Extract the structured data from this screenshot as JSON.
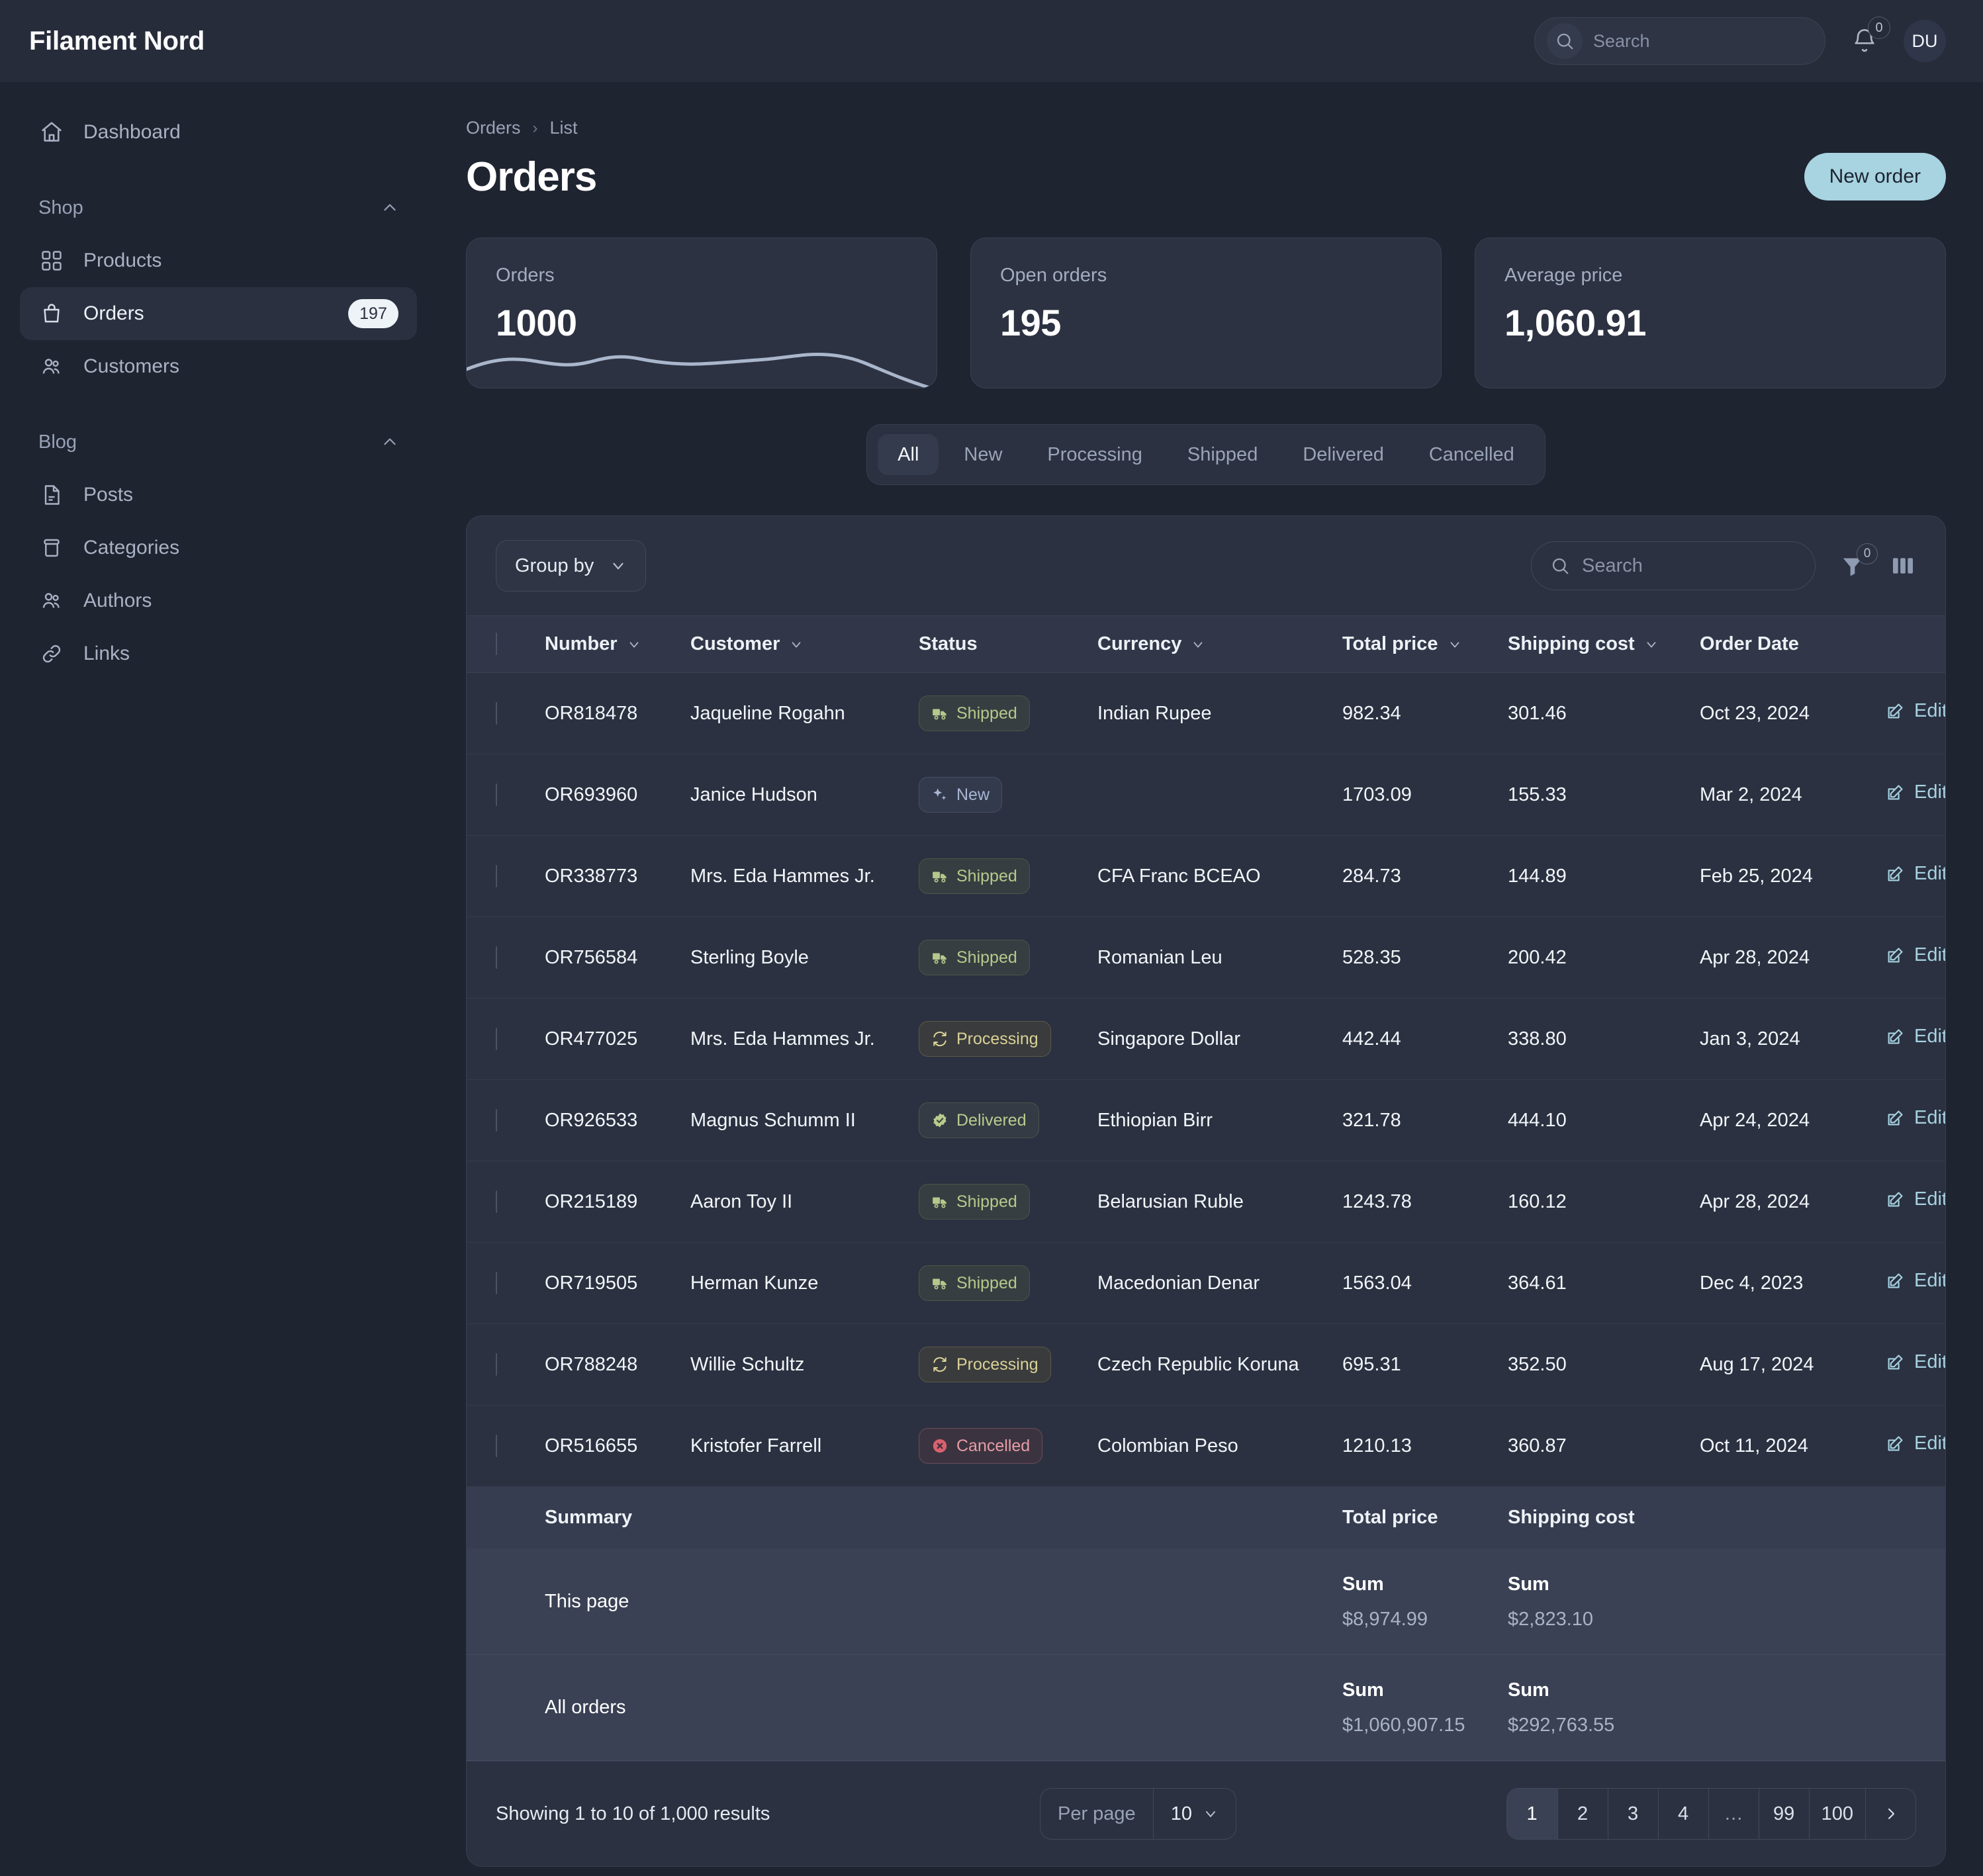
{
  "app": {
    "brand": "Filament Nord"
  },
  "topbar": {
    "search_placeholder": "Search",
    "notifications_count": "0",
    "avatar_initials": "DU"
  },
  "sidebar": {
    "dashboard": {
      "label": "Dashboard",
      "icon": "home-icon"
    },
    "groups": [
      {
        "label": "Shop",
        "items": [
          {
            "label": "Products",
            "icon": "grid-icon",
            "badge": ""
          },
          {
            "label": "Orders",
            "icon": "shopping-bag-icon",
            "badge": "197",
            "active": true
          },
          {
            "label": "Customers",
            "icon": "users-icon",
            "badge": ""
          }
        ]
      },
      {
        "label": "Blog",
        "items": [
          {
            "label": "Posts",
            "icon": "document-icon",
            "badge": ""
          },
          {
            "label": "Categories",
            "icon": "archive-box-icon",
            "badge": ""
          },
          {
            "label": "Authors",
            "icon": "users-icon",
            "badge": ""
          },
          {
            "label": "Links",
            "icon": "link-icon",
            "badge": ""
          }
        ]
      }
    ]
  },
  "breadcrumb": {
    "root": "Orders",
    "current": "List"
  },
  "header": {
    "title": "Orders",
    "new_order_label": "New order"
  },
  "stats": [
    {
      "caption": "Orders",
      "value": "1000",
      "has_spark": true
    },
    {
      "caption": "Open orders",
      "value": "195",
      "has_spark": false
    },
    {
      "caption": "Average price",
      "value": "1,060.91",
      "has_spark": false
    }
  ],
  "tabs": [
    {
      "label": "All",
      "active": true
    },
    {
      "label": "New",
      "active": false
    },
    {
      "label": "Processing",
      "active": false
    },
    {
      "label": "Shipped",
      "active": false
    },
    {
      "label": "Delivered",
      "active": false
    },
    {
      "label": "Cancelled",
      "active": false
    }
  ],
  "toolbar": {
    "group_by_label": "Group by",
    "search_placeholder": "Search",
    "filter_count": "0"
  },
  "table": {
    "columns": [
      {
        "label": "Number",
        "sortable": true
      },
      {
        "label": "Customer",
        "sortable": true
      },
      {
        "label": "Status",
        "sortable": false
      },
      {
        "label": "Currency",
        "sortable": true
      },
      {
        "label": "Total price",
        "sortable": true
      },
      {
        "label": "Shipping cost",
        "sortable": true
      },
      {
        "label": "Order Date",
        "sortable": false
      }
    ],
    "edit_label": "Edit",
    "rows": [
      {
        "number": "OR818478",
        "customer": "Jaqueline Rogahn",
        "status": "Shipped",
        "status_key": "shipped",
        "currency": "Indian Rupee",
        "total": "982.34",
        "shipping": "301.46",
        "date": "Oct 23, 2024"
      },
      {
        "number": "OR693960",
        "customer": "Janice Hudson",
        "status": "New",
        "status_key": "newb",
        "currency": "",
        "total": "1703.09",
        "shipping": "155.33",
        "date": "Mar 2, 2024"
      },
      {
        "number": "OR338773",
        "customer": "Mrs. Eda Hammes Jr.",
        "status": "Shipped",
        "status_key": "shipped",
        "currency": "CFA Franc BCEAO",
        "total": "284.73",
        "shipping": "144.89",
        "date": "Feb 25, 2024"
      },
      {
        "number": "OR756584",
        "customer": "Sterling Boyle",
        "status": "Shipped",
        "status_key": "shipped",
        "currency": "Romanian Leu",
        "total": "528.35",
        "shipping": "200.42",
        "date": "Apr 28, 2024"
      },
      {
        "number": "OR477025",
        "customer": "Mrs. Eda Hammes Jr.",
        "status": "Processing",
        "status_key": "processing",
        "currency": "Singapore Dollar",
        "total": "442.44",
        "shipping": "338.80",
        "date": "Jan 3, 2024"
      },
      {
        "number": "OR926533",
        "customer": "Magnus Schumm II",
        "status": "Delivered",
        "status_key": "delivered",
        "currency": "Ethiopian Birr",
        "total": "321.78",
        "shipping": "444.10",
        "date": "Apr 24, 2024"
      },
      {
        "number": "OR215189",
        "customer": "Aaron Toy II",
        "status": "Shipped",
        "status_key": "shipped",
        "currency": "Belarusian Ruble",
        "total": "1243.78",
        "shipping": "160.12",
        "date": "Apr 28, 2024"
      },
      {
        "number": "OR719505",
        "customer": "Herman Kunze",
        "status": "Shipped",
        "status_key": "shipped",
        "currency": "Macedonian Denar",
        "total": "1563.04",
        "shipping": "364.61",
        "date": "Dec 4, 2023"
      },
      {
        "number": "OR788248",
        "customer": "Willie Schultz",
        "status": "Processing",
        "status_key": "processing",
        "currency": "Czech Republic Koruna",
        "total": "695.31",
        "shipping": "352.50",
        "date": "Aug 17, 2024"
      },
      {
        "number": "OR516655",
        "customer": "Kristofer Farrell",
        "status": "Cancelled",
        "status_key": "cancelled",
        "currency": "Colombian Peso",
        "total": "1210.13",
        "shipping": "360.87",
        "date": "Oct 11, 2024"
      }
    ],
    "summary": {
      "title": "Summary",
      "col_total_label": "Total price",
      "col_shipping_label": "Shipping cost",
      "rows": [
        {
          "label": "This page",
          "total_kind": "Sum",
          "total_value": "$8,974.99",
          "shipping_kind": "Sum",
          "shipping_value": "$2,823.10"
        },
        {
          "label": "All orders",
          "total_kind": "Sum",
          "total_value": "$1,060,907.15",
          "shipping_kind": "Sum",
          "shipping_value": "$292,763.55"
        }
      ]
    }
  },
  "footer": {
    "showing": "Showing 1 to 10 of 1,000 results",
    "per_page_label": "Per page",
    "per_page_value": "10",
    "pages": [
      "1",
      "2",
      "3",
      "4",
      "…",
      "99",
      "100"
    ],
    "active_page": "1"
  },
  "colors": {
    "accent": "#a8d3e0",
    "panel": "#2b3140",
    "page_bg": "#1f2431",
    "shipped": "#b6c98b",
    "processing": "#d9d197",
    "delivered": "#b9cc8e",
    "cancelled": "#e79ca6",
    "new": "#a8b6d4"
  }
}
